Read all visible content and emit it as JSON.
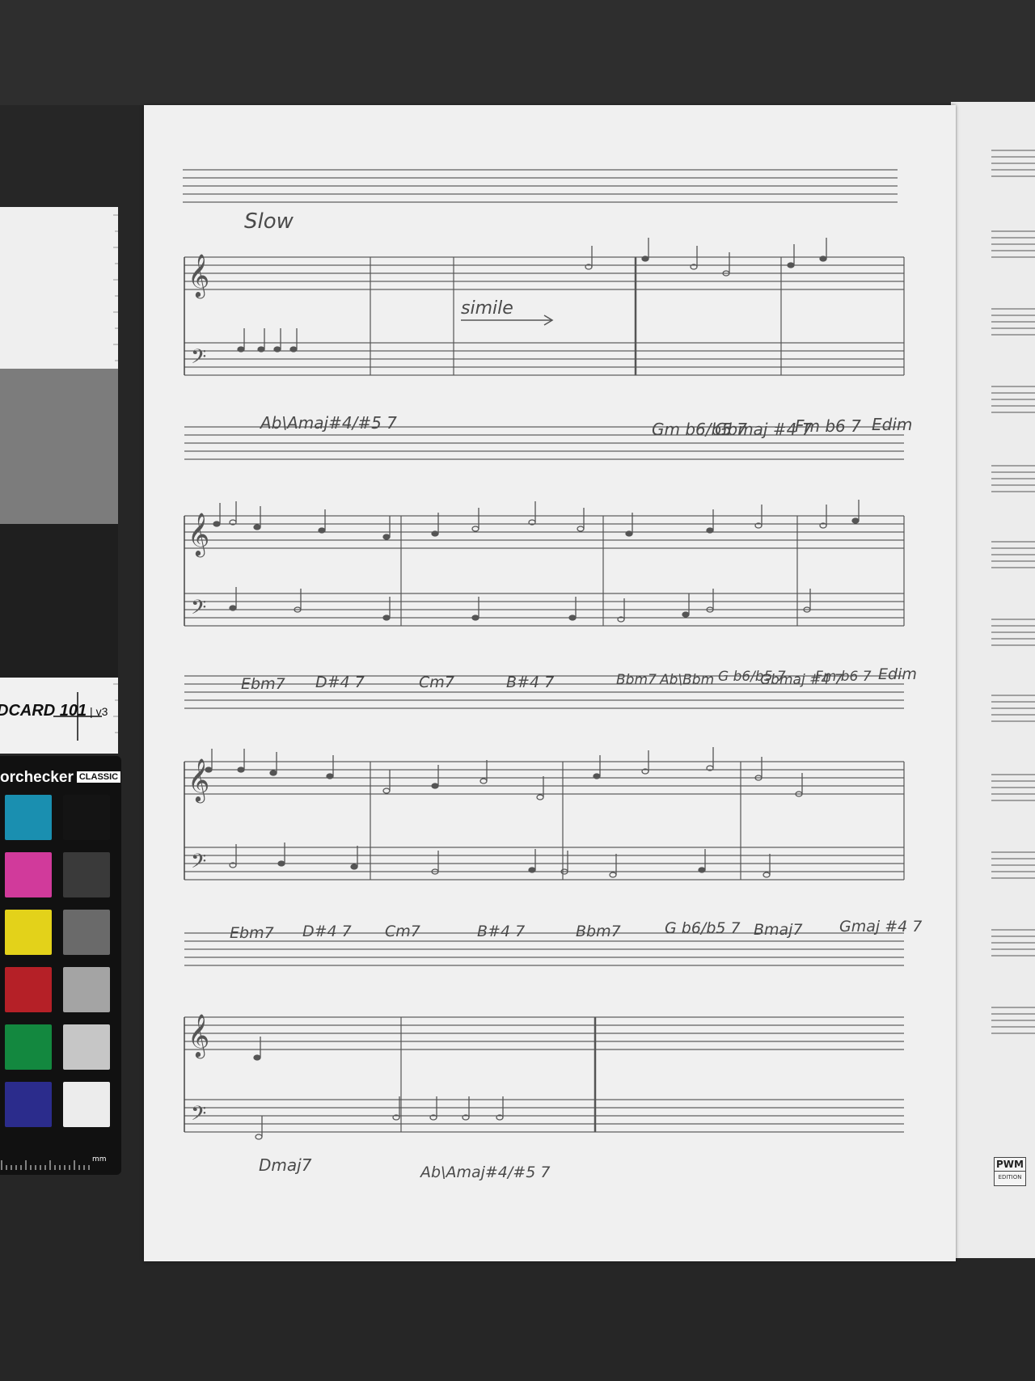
{
  "tempo_marking": "Slow",
  "simile_marking": "simile",
  "chord_lines": [
    [
      "Ab\\Amaj#4/#5 7",
      "Gm b6/b5 7",
      "Gbmaj #4 7",
      "Fm b6 7",
      "Edim"
    ],
    [
      "Ebm7",
      "D#4 7",
      "Cm7",
      "B#4 7",
      "Bbm7",
      "Ab\\Bbm",
      "G b6/b5 7",
      "Gbmaj #4 7",
      "Fm b6 7",
      "Edim"
    ],
    [
      "Ebm7",
      "D#4 7",
      "Cm7",
      "B#4 7",
      "Bbm7",
      "G b6/b5 7",
      "Bmaj7",
      "Gmaj #4 7"
    ],
    [
      "Dmaj7",
      "Ab\\Amaj#4/#5 7"
    ]
  ],
  "target_card": {
    "label": "DCARD 101",
    "version": "v3"
  },
  "color_checker": {
    "brand": "orchecker",
    "edition": "CLASSIC",
    "scale_unit": "mm",
    "swatches_left": [
      "#1a8fb0",
      "#d13a9b",
      "#e3d21a",
      "#b52027",
      "#13883f",
      "#2b2c8c"
    ],
    "swatches_right": [
      "#141414",
      "#3a3a3a",
      "#6a6a6a",
      "#a4a4a4",
      "#c6c6c6",
      "#ececec"
    ]
  },
  "publisher_mark": {
    "title": "PWM",
    "subtitle": "EDITION"
  }
}
